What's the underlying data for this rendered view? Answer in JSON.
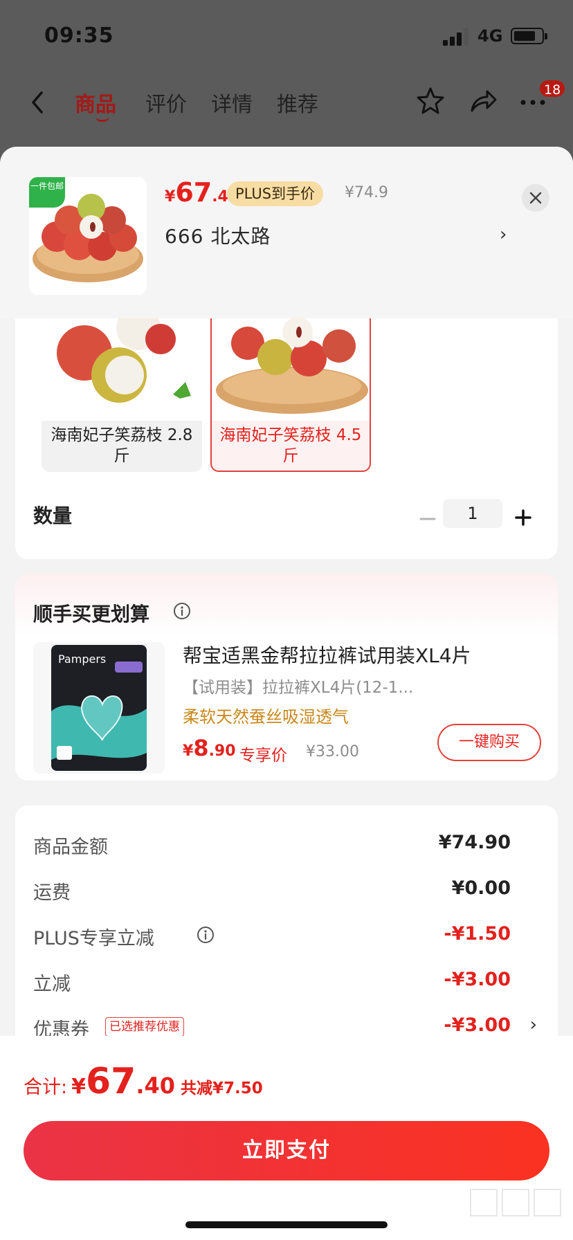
{
  "status_bar": {
    "time": "09:35",
    "network": "4G"
  },
  "nav": {
    "tabs": [
      {
        "label": "商品"
      },
      {
        "label": "评价"
      },
      {
        "label": "详情"
      },
      {
        "label": "推荐"
      }
    ],
    "cart_badge": "18"
  },
  "header": {
    "free_shipping_tag": "一件包邮",
    "price_currency": "¥",
    "price_int": "67",
    "price_dec": ".4",
    "plus_tag": "PLUS到手价",
    "original_price": "¥74.9",
    "address": "666  北太路"
  },
  "spec": {
    "options": [
      {
        "label": "海南妃子笑荔枝 2.8斤",
        "selected": false
      },
      {
        "label": "海南妃子笑荔枝 4.5斤",
        "selected": true
      }
    ],
    "quantity_label": "数量",
    "quantity_value": "1"
  },
  "recommend": {
    "title": "顺手买更划算",
    "product_name": "帮宝适黑金帮拉拉裤试用装XL4片",
    "product_subtitle": "【试用装】拉拉裤XL4片(12-1...",
    "selling_point": "柔软天然蚕丝吸湿透气",
    "price_currency": "¥",
    "price_int": "8",
    "price_dec": ".90",
    "price_tag": "专享价",
    "original_price": "¥33.00",
    "buy_button": "一键购买",
    "package_brand": "Pampers"
  },
  "summary": {
    "rows": [
      {
        "label": "商品金额",
        "value": "¥74.90",
        "highlight": false
      },
      {
        "label": "运费",
        "value": "¥0.00",
        "highlight": false
      },
      {
        "label": "PLUS专享立减",
        "value": "-¥1.50",
        "highlight": true
      },
      {
        "label": "立减",
        "value": "-¥3.00",
        "highlight": true
      },
      {
        "label": "优惠券",
        "value": "-¥3.00",
        "highlight": true
      }
    ],
    "coupon_tag": "已选推荐优惠"
  },
  "footer": {
    "total_label": "合计:",
    "total_currency": "¥",
    "total_int": "67",
    "total_dec": ".40",
    "total_saved": "共减¥7.50",
    "pay_button": "立即支付"
  },
  "colors": {
    "accent_red": "#e3211d",
    "plus_gold": "#f7dda4",
    "pay_gradient_start": "#ea3346",
    "pay_gradient_end": "#fa3221"
  }
}
